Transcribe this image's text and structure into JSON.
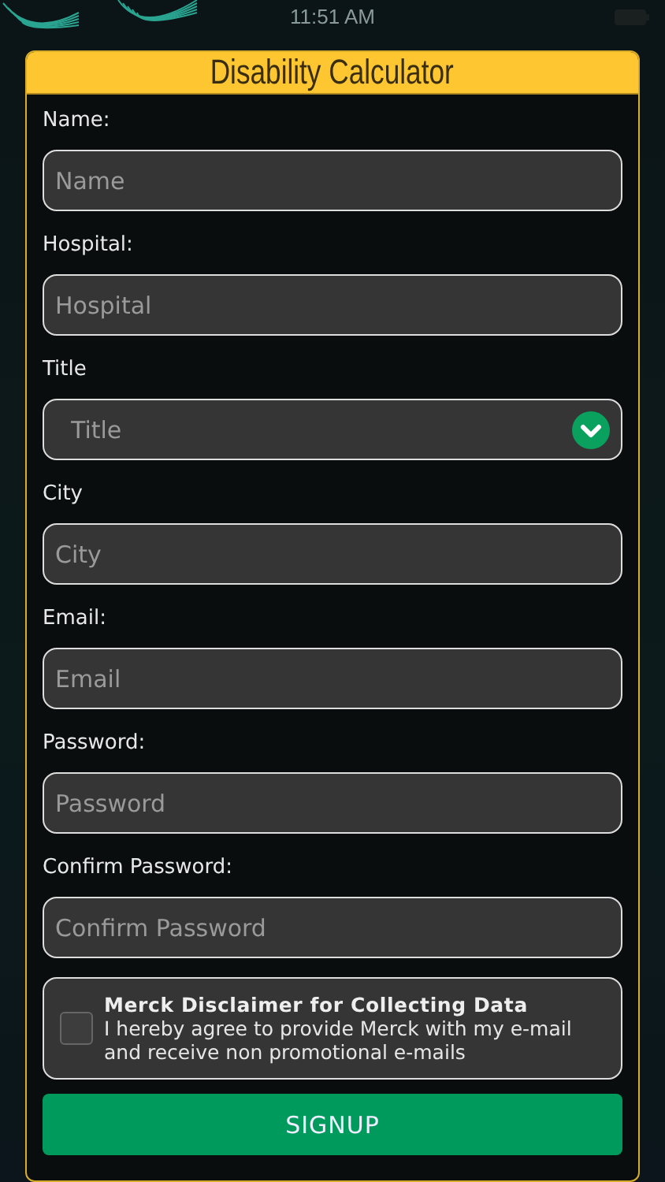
{
  "status_bar": {
    "time": "11:51 AM"
  },
  "card": {
    "title": "Disability Calculator"
  },
  "fields": [
    {
      "kind": "text",
      "label": "Name:",
      "placeholder": "Name"
    },
    {
      "kind": "text",
      "label": "Hospital:",
      "placeholder": "Hospital"
    },
    {
      "kind": "select",
      "label": "Title",
      "placeholder": "Title"
    },
    {
      "kind": "text",
      "label": "City",
      "placeholder": "City"
    },
    {
      "kind": "text",
      "label": "Email:",
      "placeholder": "Email"
    },
    {
      "kind": "password",
      "label": "Password:",
      "placeholder": "Password"
    },
    {
      "kind": "password",
      "label": "Confirm Password:",
      "placeholder": "Confirm Password"
    }
  ],
  "disclaimer": {
    "checked": false,
    "title": "Merck Disclaimer for Collecting Data",
    "text": "I hereby agree to provide Merck with my e-mail and receive non promotional e-mails"
  },
  "button": "SIGNUP"
}
